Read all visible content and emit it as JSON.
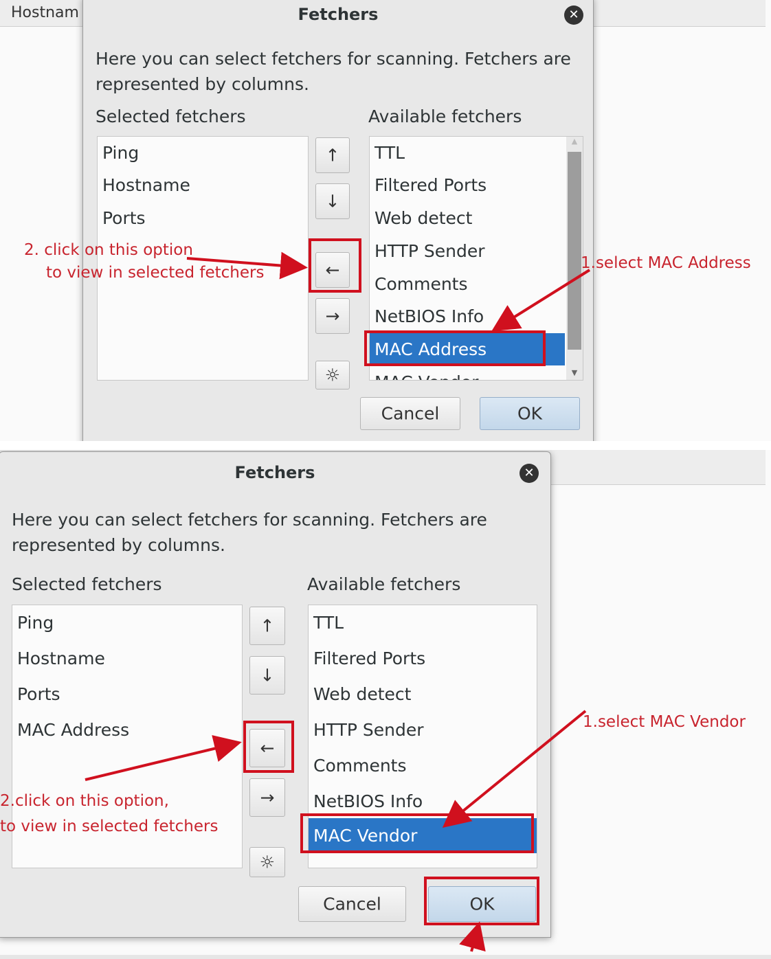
{
  "panel1": {
    "background_header_text": "Hostnam",
    "dialog": {
      "title": "Fetchers",
      "description_line1": "Here you can select fetchers for scanning. Fetchers are",
      "description_line2": "represented by columns.",
      "selected_label": "Selected fetchers",
      "available_label": "Available fetchers",
      "selected_items": [
        "Ping",
        "Hostname",
        "Ports"
      ],
      "available_items": [
        "TTL",
        "Filtered Ports",
        "Web detect",
        "HTTP Sender",
        "Comments",
        "NetBIOS Info",
        "MAC Address",
        "MAC Vendor"
      ],
      "selected_available_item": "MAC Address",
      "cancel_label": "Cancel",
      "ok_label": "OK"
    },
    "annotations": {
      "step2_line1": "2. click on this option",
      "step2_line2": "to view in selected fetchers",
      "step1": "1.select MAC Address"
    }
  },
  "panel2": {
    "dialog": {
      "title": "Fetchers",
      "description_line1": "Here you can select fetchers for scanning. Fetchers are",
      "description_line2": "represented by columns.",
      "selected_label": "Selected fetchers",
      "available_label": "Available fetchers",
      "selected_items": [
        "Ping",
        "Hostname",
        "Ports",
        "MAC Address"
      ],
      "available_items": [
        "TTL",
        "Filtered Ports",
        "Web detect",
        "HTTP Sender",
        "Comments",
        "NetBIOS Info",
        "MAC Vendor"
      ],
      "selected_available_item": "MAC Vendor",
      "cancel_label": "Cancel",
      "ok_label": "OK"
    },
    "annotations": {
      "step2_line1": "2.click on this option,",
      "step2_line2": "to view in  selected fetchers",
      "step1": "1.select MAC Vendor"
    }
  },
  "icons": {
    "up": "↑",
    "down": "↓",
    "left": "←",
    "right": "→",
    "settings": "☼",
    "close": "✕",
    "scroll_up": "▲",
    "scroll_down": "▼"
  },
  "colors": {
    "selection": "#2a76c6",
    "annotation": "#d0101e"
  }
}
